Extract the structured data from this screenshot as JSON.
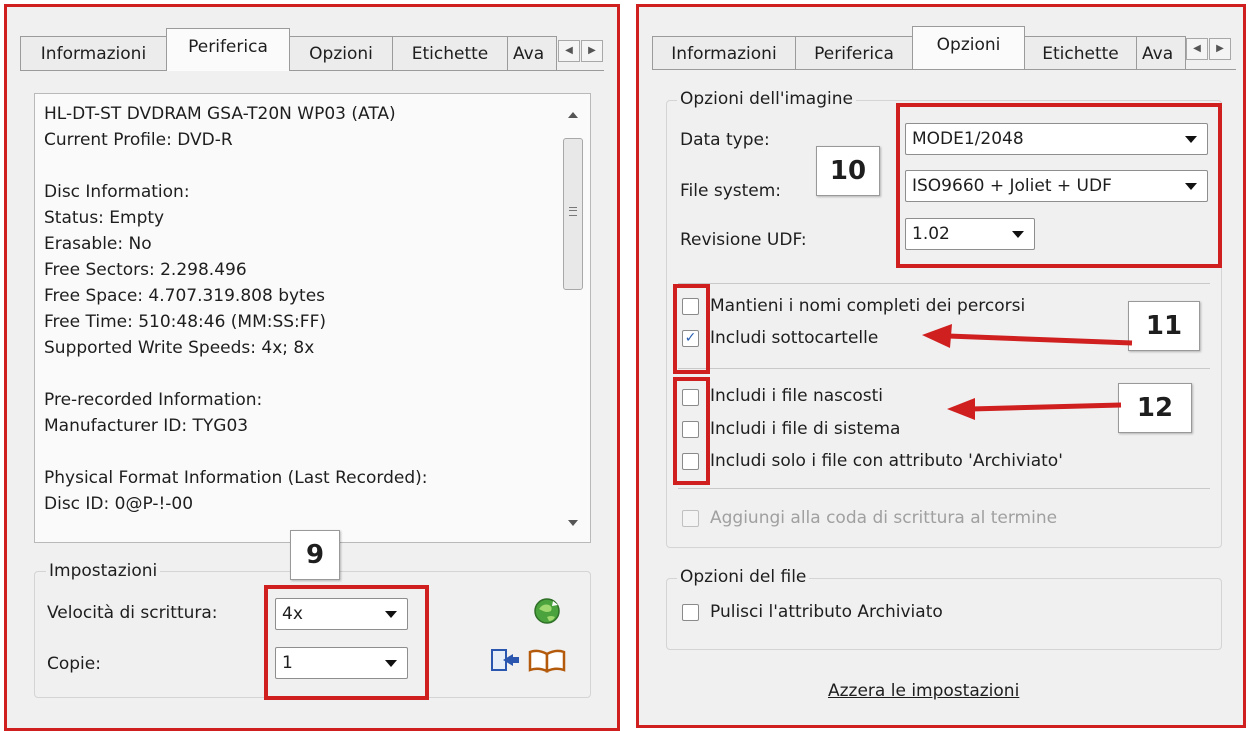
{
  "left_panel": {
    "tabs": [
      {
        "label": "Informazioni"
      },
      {
        "label": "Periferica"
      },
      {
        "label": "Opzioni"
      },
      {
        "label": "Etichette"
      },
      {
        "label": "Ava"
      }
    ],
    "active_tab": "Periferica",
    "device_info": [
      "HL-DT-ST DVDRAM GSA-T20N WP03 (ATA)",
      "Current Profile: DVD-R",
      "",
      "Disc Information:",
      "Status: Empty",
      "Erasable: No",
      "Free Sectors: 2.298.496",
      "Free Space: 4.707.319.808 bytes",
      "Free Time: 510:48:46 (MM:SS:FF)",
      "Supported Write Speeds: 4x; 8x",
      "",
      "Pre-recorded Information:",
      "Manufacturer ID: TYG03",
      "",
      "Physical Format Information (Last Recorded):",
      "Disc ID: 0@P-!-00"
    ],
    "settings": {
      "legend": "Impostazioni",
      "write_speed_label": "Velocità di scrittura:",
      "write_speed_value": "4x",
      "copies_label": "Copie:",
      "copies_value": "1"
    },
    "callout": "9"
  },
  "right_panel": {
    "tabs": [
      {
        "label": "Informazioni"
      },
      {
        "label": "Periferica"
      },
      {
        "label": "Opzioni"
      },
      {
        "label": "Etichette"
      },
      {
        "label": "Ava"
      }
    ],
    "active_tab": "Opzioni",
    "image_options": {
      "legend": "Opzioni dell'imagine",
      "data_type_label": "Data type:",
      "data_type_value": "MODE1/2048",
      "file_system_label": "File system:",
      "file_system_value": "ISO9660 + Joliet + UDF",
      "udf_revision_label": "Revisione UDF:",
      "udf_revision_value": "1.02"
    },
    "checkboxes": [
      {
        "label": "Mantieni i nomi completi dei percorsi",
        "checked": false,
        "enabled": true
      },
      {
        "label": "Includi sottocartelle",
        "checked": true,
        "enabled": true
      },
      {
        "label": "Includi i file nascosti",
        "checked": false,
        "enabled": true
      },
      {
        "label": "Includi i file di sistema",
        "checked": false,
        "enabled": true
      },
      {
        "label": "Includi solo i file con attributo 'Archiviato'",
        "checked": false,
        "enabled": true
      },
      {
        "label": "Aggiungi alla coda di scrittura al termine",
        "checked": false,
        "enabled": false
      }
    ],
    "file_options": {
      "legend": "Opzioni del file",
      "clear_archive_label": "Pulisci l'attributo Archiviato",
      "clear_archive_checked": false
    },
    "reset_link": "Azzera le impostazioni",
    "callouts": [
      "10",
      "11",
      "12"
    ]
  },
  "colors": {
    "highlight_red": "#d01f1f",
    "panel_bg": "#f0f0f0",
    "check_blue": "#2a5fb0"
  }
}
